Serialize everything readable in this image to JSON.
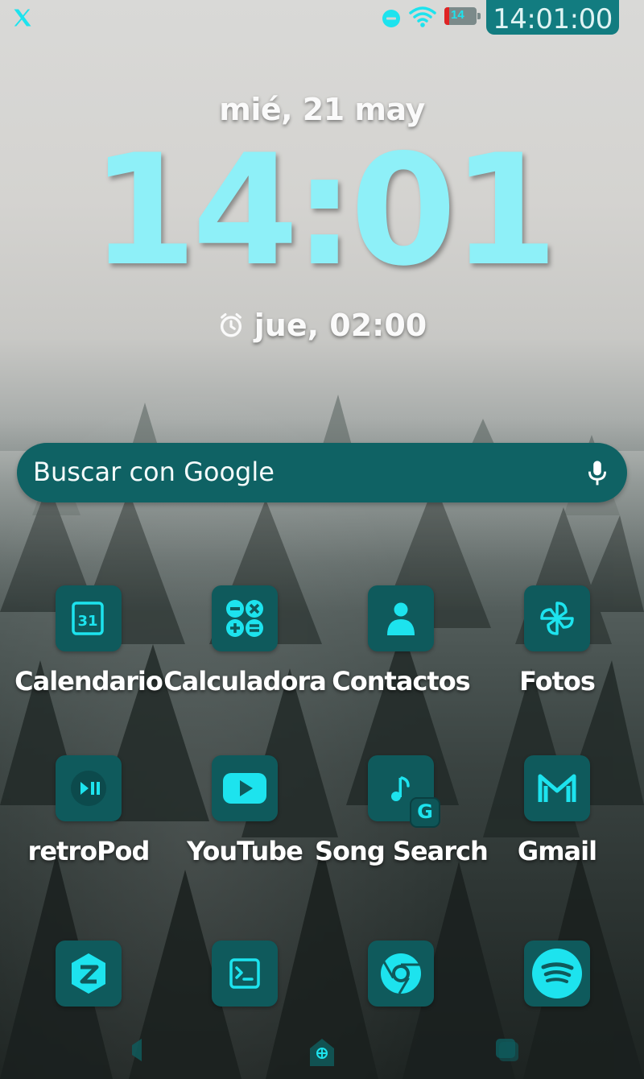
{
  "status_bar": {
    "app_icon": "x-logo-icon",
    "battery_level": 14,
    "battery_label": "14",
    "time": "14:01:00",
    "icons": [
      "do-not-disturb-icon",
      "wifi-icon",
      "battery-icon"
    ]
  },
  "clock_widget": {
    "date": "mié, 21 may",
    "time": "14:01",
    "alarm_icon": "alarm-clock-icon",
    "alarm": "jue, 02:00"
  },
  "search": {
    "placeholder": "Buscar con Google",
    "icon": "microphone-icon"
  },
  "apps": [
    {
      "label": "Calendario",
      "icon": "calendar-icon"
    },
    {
      "label": "Calculadora",
      "icon": "calculator-icon"
    },
    {
      "label": "Contactos",
      "icon": "contacts-icon"
    },
    {
      "label": "Fotos",
      "icon": "photos-pinwheel-icon"
    },
    {
      "label": "retroPod",
      "icon": "play-pause-icon"
    },
    {
      "label": "YouTube",
      "icon": "youtube-icon"
    },
    {
      "label": "Song Search",
      "icon": "music-note-icon",
      "badge": "G"
    },
    {
      "label": "Gmail",
      "icon": "gmail-icon"
    }
  ],
  "dock": [
    {
      "icon": "zarchiver-icon"
    },
    {
      "icon": "terminal-icon"
    },
    {
      "icon": "chrome-icon"
    },
    {
      "icon": "spotify-icon"
    }
  ],
  "colors": {
    "accent": "#1de3ee",
    "clock": "#8ef0f8",
    "tile": "#0f5a5c",
    "search_bg": "#0f6264",
    "status_pill": "#127c80"
  }
}
